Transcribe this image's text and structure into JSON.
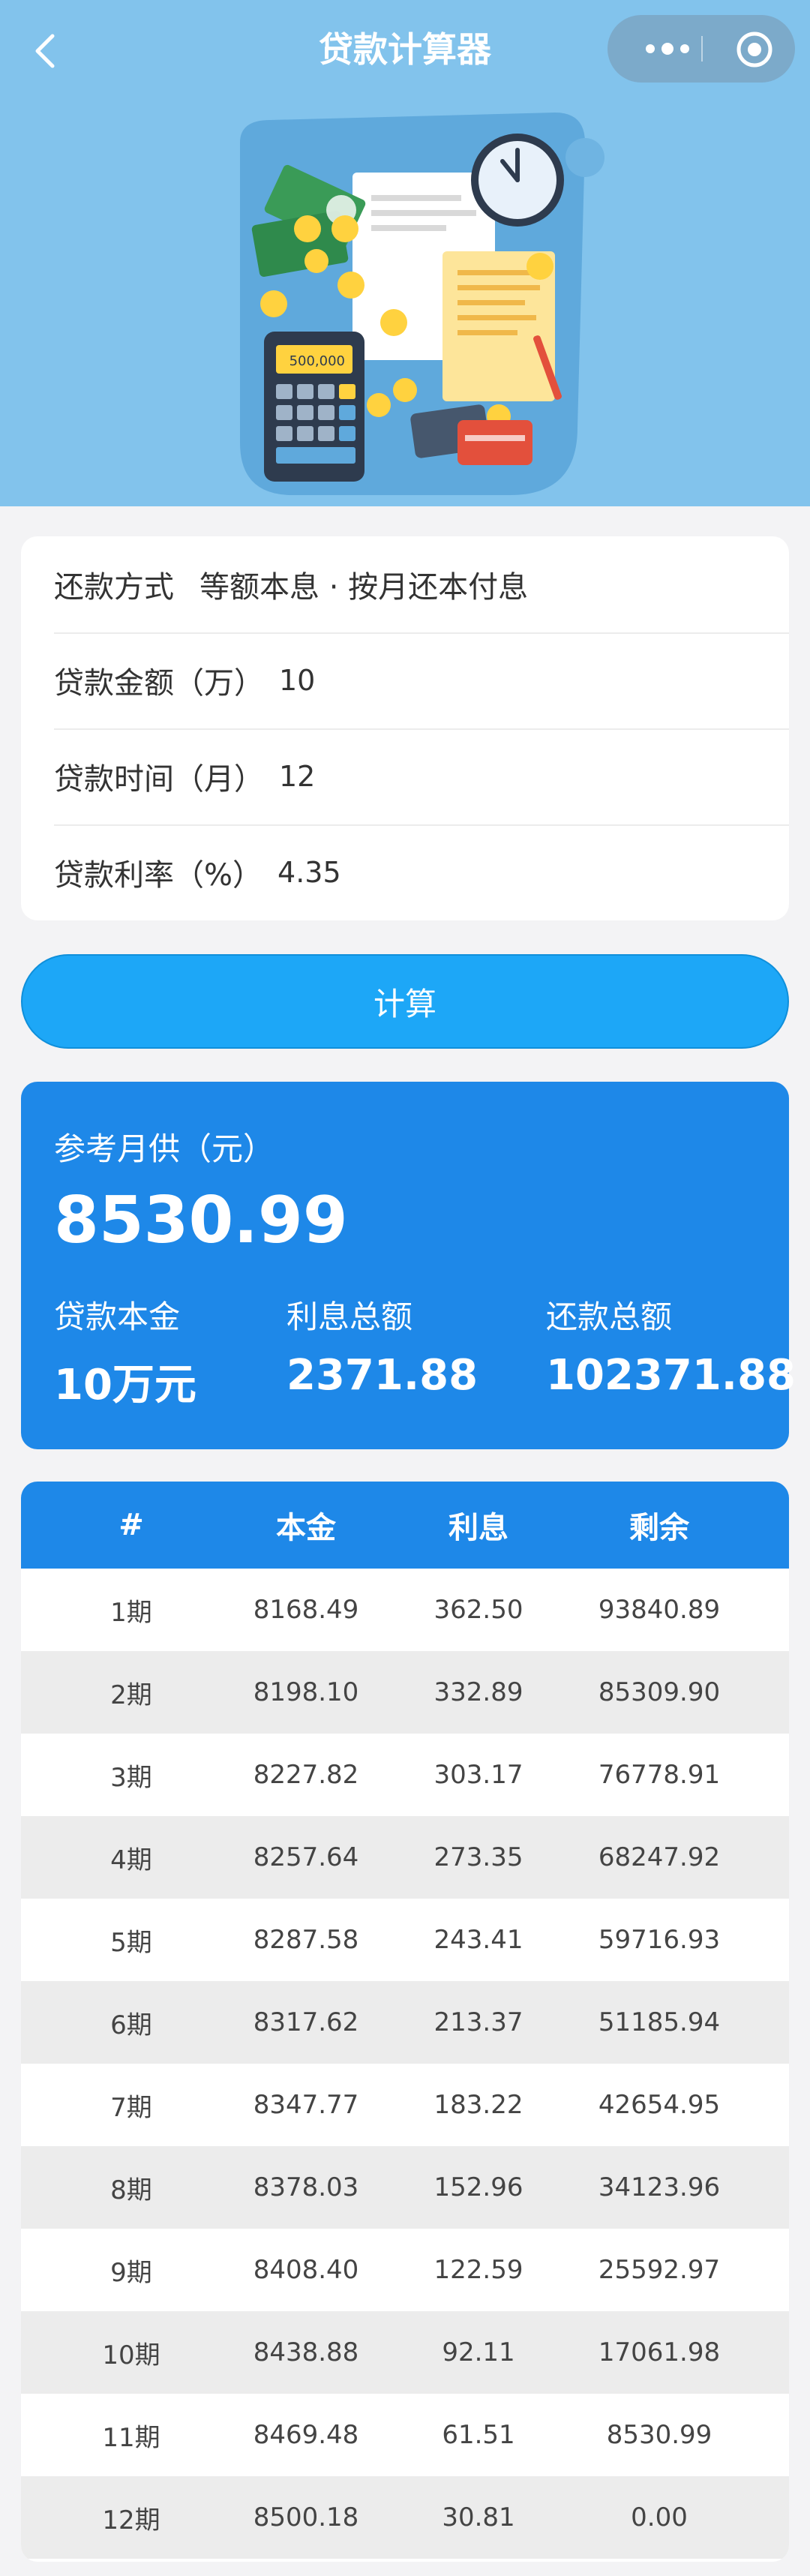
{
  "header": {
    "title": "贷款计算器",
    "back_icon": "chevron-left-icon",
    "more_icon": "more-dots-icon",
    "close_icon": "target-circle-icon"
  },
  "hero": {
    "illustration": "finance-illustration",
    "calculator_display": "500,000",
    "background_color": "#82c3ec"
  },
  "form": {
    "rows": [
      {
        "label": "还款方式",
        "value": "等额本息 · 按月还本付息"
      },
      {
        "label": "贷款金额（万）",
        "value": "10"
      },
      {
        "label": "贷款时间（月）",
        "value": "12"
      },
      {
        "label": "贷款利率（%）",
        "value": "4.35"
      }
    ]
  },
  "calculate_button": {
    "label": "计算",
    "color": "#1da7f7"
  },
  "result": {
    "label": "参考月供（元）",
    "monthly_payment": "8530.99",
    "stats": [
      {
        "label": "贷款本金",
        "value": "10万元"
      },
      {
        "label": "利息总额",
        "value": "2371.88"
      },
      {
        "label": "还款总额",
        "value": "102371.88"
      }
    ],
    "color": "#1e88e8"
  },
  "schedule": {
    "headers": [
      "#",
      "本金",
      "利息",
      "剩余"
    ],
    "rows": [
      [
        "1期",
        "8168.49",
        "362.50",
        "93840.89"
      ],
      [
        "2期",
        "8198.10",
        "332.89",
        "85309.90"
      ],
      [
        "3期",
        "8227.82",
        "303.17",
        "76778.91"
      ],
      [
        "4期",
        "8257.64",
        "273.35",
        "68247.92"
      ],
      [
        "5期",
        "8287.58",
        "243.41",
        "59716.93"
      ],
      [
        "6期",
        "8317.62",
        "213.37",
        "51185.94"
      ],
      [
        "7期",
        "8347.77",
        "183.22",
        "42654.95"
      ],
      [
        "8期",
        "8378.03",
        "152.96",
        "34123.96"
      ],
      [
        "9期",
        "8408.40",
        "122.59",
        "25592.97"
      ],
      [
        "10期",
        "8438.88",
        "92.11",
        "17061.98"
      ],
      [
        "11期",
        "8469.48",
        "61.51",
        "8530.99"
      ],
      [
        "12期",
        "8500.18",
        "30.81",
        "0.00"
      ]
    ]
  }
}
